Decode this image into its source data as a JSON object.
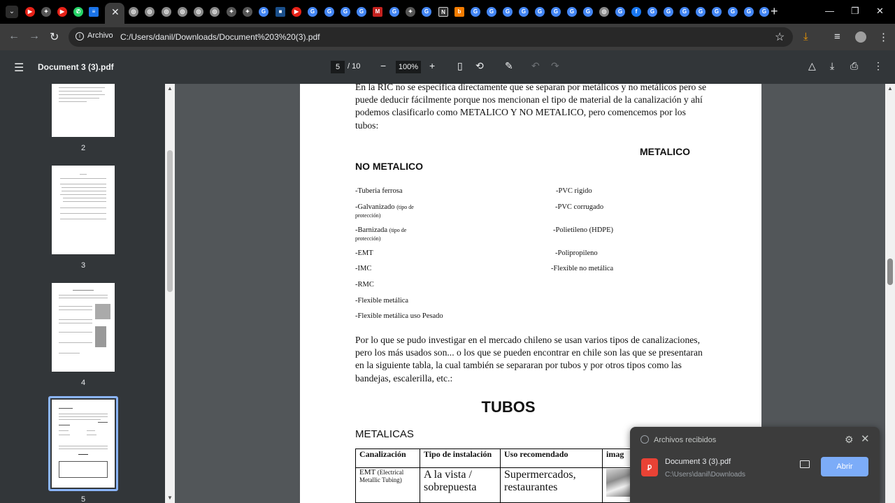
{
  "browser": {
    "url": "C:/Users/danil/Downloads/Document%203%20(3).pdf",
    "site_chip": "Archivo"
  },
  "pdf": {
    "title": "Document 3 (3).pdf",
    "current_page": "5",
    "page_total": "/ 10",
    "zoom": "100%"
  },
  "thumbnails": [
    {
      "label": "2"
    },
    {
      "label": "3"
    },
    {
      "label": "4"
    },
    {
      "label": "5"
    }
  ],
  "document": {
    "intro": "En la RIC no se especifica directamente que se separan por metálicos y no metálicos pero se puede deducir fácilmente porque nos mencionan el tipo de material de la canalización y ahí podemos clasificarlo como METALICO Y NO METALICO, pero comencemos por  los tubos:",
    "heading_metalico": "METALICO",
    "heading_no_metalico": "NO METALICO",
    "left_list": [
      {
        "text": "-Tuberia ferrosa",
        "note": ""
      },
      {
        "text": "-Galvanizado ",
        "note": "(tipo de protección)"
      },
      {
        "text": "-Barnizada ",
        "note": "(tipo de protección)"
      },
      {
        "text": "-EMT",
        "note": ""
      },
      {
        "text": "-IMC",
        "note": ""
      },
      {
        "text": "-RMC",
        "note": ""
      },
      {
        "text": "-Flexible metálica",
        "note": ""
      },
      {
        "text": "-Flexible metálica uso Pesado",
        "note": ""
      }
    ],
    "right_list": [
      "-PVC rigido",
      "-PVC corrugado",
      "-Polietileno (HDPE)",
      "-Polipropileno",
      "-Flexible no metálica"
    ],
    "para2": "Por lo que se pudo investigar en el mercado chileno se usan varios tipos de canalizaciones, pero los más usados son... o los que se pueden encontrar en chile son las que se presentaran en la siguiente tabla, la cual también se separaran por tubos y por otros tipos como las bandejas, escalerilla, etc.:",
    "tubos_title": "TUBOS",
    "metalicas_label": "METALICAS",
    "table": {
      "headers": [
        "Canalización",
        "Tipo de instalación",
        "Uso recomendado",
        "imag"
      ],
      "row1": {
        "canalizacion": "EMT",
        "canalizacion_note": "(Electrical Metallic Tubing)",
        "tipo": "A la vista / sobrepuesta",
        "uso": "Supermercados, restaurantes"
      }
    }
  },
  "downloads_popup": {
    "title": "Archivos recibidos",
    "file_name": "Document 3 (3).pdf",
    "file_path": "C:\\Users\\danil\\Downloads",
    "open_label": "Abrir"
  },
  "colors": {
    "accent": "#8ab4f8",
    "open_button": "#7cacf8",
    "pdf_icon": "#e94235"
  }
}
